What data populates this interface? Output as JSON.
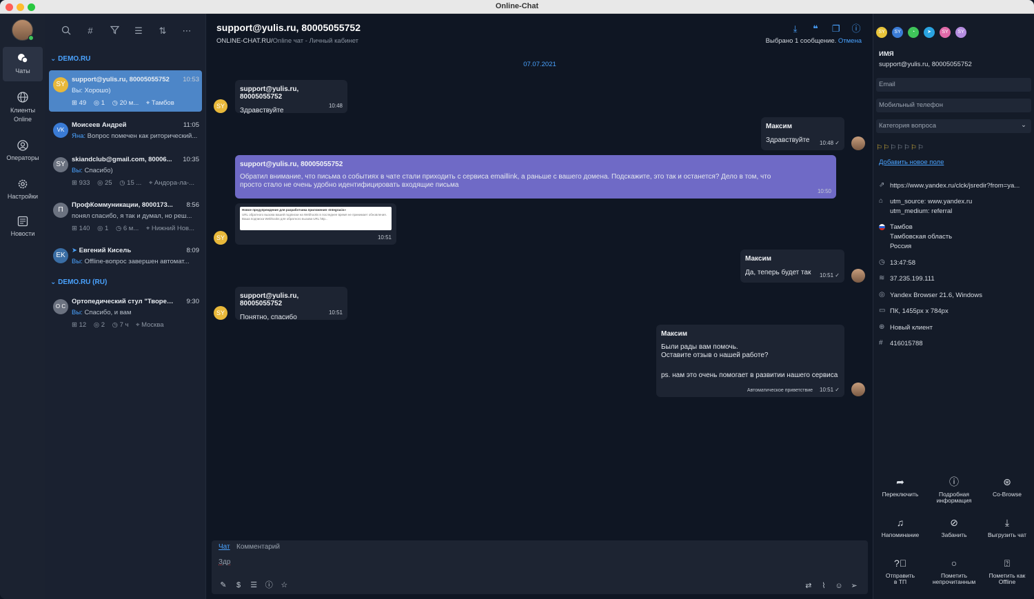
{
  "window": {
    "title": "Online-Chat"
  },
  "rail": {
    "items": [
      {
        "label": "Чаты"
      },
      {
        "label": "Клиенты Online"
      },
      {
        "label": "Операторы"
      },
      {
        "label": "Настройки"
      },
      {
        "label": "Новости"
      }
    ]
  },
  "chatlist": {
    "groups": [
      {
        "name": "DEMO.RU"
      },
      {
        "name": "DEMO.RU (RU)"
      }
    ],
    "chats": [
      {
        "initials": "SY",
        "name": "support@yulis.ru, 80005055752",
        "time": "10:53",
        "who": "Вы:",
        "preview": " Хорошо)",
        "m1": "⊞ 49",
        "m2": "◎ 1",
        "m3": "◷ 20 м...",
        "m4": "⌖ Тамбов",
        "color": "#e8b83a"
      },
      {
        "initials": "VK",
        "name": "Моисеев Андрей",
        "time": "11:05",
        "who": "Яна:",
        "preview": " Вопрос помечен как риторический...",
        "color": "#3a7bd5"
      },
      {
        "initials": "SY",
        "name": "skiandclub@gmail.com, 80006...",
        "time": "10:35",
        "who": "Вы:",
        "preview": " Спасибо)",
        "m1": "⊞ 933",
        "m2": "◎ 25",
        "m3": "◷ 15 ...",
        "m4": "⌖ Андора-ла-...",
        "color": "#6b7280"
      },
      {
        "initials": "П",
        "name": "ПрофКоммуникации, 8000173...",
        "time": "8:56",
        "who": "",
        "preview": "понял спасибо, я так и думал, но реш...",
        "m1": "⊞ 140",
        "m2": "◎ 1",
        "m3": "◷ 6 м...",
        "m4": "⌖ Нижний Нов...",
        "color": "#6b7280"
      },
      {
        "initials": "EK",
        "name": "Евгений Кисель",
        "time": "8:09",
        "who": "Вы:",
        "preview": " Offline-вопрос завершен автомат...",
        "color": "#3a6ea5"
      },
      {
        "initials": "О С",
        "name": "Ортопедический стул \"Творец...",
        "time": "9:30",
        "who": "Вы:",
        "preview": " Спасибо, и вам",
        "m1": "⊞ 12",
        "m2": "◎ 2",
        "m3": "◷ 7 ч",
        "m4": "⌖ Москва",
        "color": "#6b7280"
      }
    ]
  },
  "main": {
    "title": "support@yulis.ru, 80005055752",
    "sub_site": "ONLINE-CHAT.RU/",
    "sub_rest": "Online чат - Личный кабинет",
    "selected_text": "Выбрано 1 сообщение. ",
    "cancel": "Отмена",
    "date": "07.07.2021",
    "messages": [
      {
        "sender": "support@yulis.ru, 80005055752",
        "text": "Здравствуйте",
        "time": "10:48"
      },
      {
        "sender": "Максим",
        "text": "Здравствуйте",
        "time": "10:48 ✓"
      },
      {
        "sender": "support@yulis.ru, 80005055752",
        "text": "Обратил внимание, что письма о событиях в чате стали приходить с сервиса emaillink, а раньше с вашего домена. Подскажите, это так и останется? Дело в том, что просто стало не очень удобно идентифицировать входящие письма",
        "time": "10:50"
      },
      {
        "sender": "",
        "text": "",
        "time": "10:51"
      },
      {
        "sender": "Максим",
        "text": "Да, теперь будет так",
        "time": "10:51 ✓"
      },
      {
        "sender": "support@yulis.ru, 80005055752",
        "text": "Понятно, спасибо",
        "time": "10:51"
      },
      {
        "sender": "Максим",
        "line1": "Были рады вам помочь.",
        "line2": "Оставите отзыв о нашей работе?",
        "line3": "ps. нам это очень помогает в развитии нашего сервиса",
        "note": "Автоматическое приветствие",
        "time": "10:51 ✓"
      }
    ],
    "attachment": {
      "title": "Новое предупреждение для разработчика приложения «Integracio»",
      "body": "URL обратного вызова вашей подписки на Webhooks в последнее время не принимает обновления. Ваша подписка Webhooks для обратного вызова URL http..."
    },
    "composer": {
      "tab_chat": "Чат",
      "tab_comment": "Комментарий",
      "draft": "Здр"
    }
  },
  "right": {
    "name_label": "ИМЯ",
    "name_value": "support@yulis.ru, 80005055752",
    "email_placeholder": "Email",
    "phone_placeholder": "Мобильный телефон",
    "category": "Категория вопроса",
    "add_field": "Добавить новое поле",
    "info": [
      "https://www.yandex.ru/clck/jsredir?from=ya...",
      "utm_source: www.yandex.ru",
      "utm_medium: referral",
      "Тамбов",
      "Тамбовская область",
      "Россия",
      "13:47:58",
      "37.235.199.111",
      "Yandex Browser 21.6, Windows",
      "ПК, 1455px x 784px",
      "Новый клиент",
      "416015788"
    ],
    "actions": [
      {
        "l1": "Переключить",
        "l2": ""
      },
      {
        "l1": "Подробная",
        "l2": "информация"
      },
      {
        "l1": "Co-Browse",
        "l2": ""
      },
      {
        "l1": "Напоминание",
        "l2": ""
      },
      {
        "l1": "Забанить",
        "l2": ""
      },
      {
        "l1": "Выгрузить чат",
        "l2": ""
      },
      {
        "l1": "Отправить",
        "l2": "в ТП"
      },
      {
        "l1": "Пометить",
        "l2": "непрочитанным"
      },
      {
        "l1": "Пометить как",
        "l2": "Offline"
      }
    ],
    "channel_labels": [
      "SY",
      "SY",
      "SY",
      "SY"
    ]
  }
}
